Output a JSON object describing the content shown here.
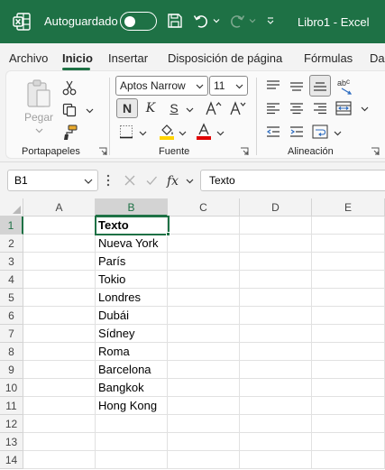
{
  "titlebar": {
    "autosave_label": "Autoguardado",
    "doc_title": "Libro1  -  Excel",
    "autosave_on": false
  },
  "tabs": [
    {
      "label": "Archivo",
      "active": false
    },
    {
      "label": "Inicio",
      "active": true
    },
    {
      "label": "Insertar",
      "active": false
    },
    {
      "label": "Disposición de página",
      "active": false
    },
    {
      "label": "Fórmulas",
      "active": false
    },
    {
      "label": "Da",
      "active": false
    }
  ],
  "ribbon": {
    "paste_label": "Pegar",
    "font_name": "Aptos Narrow",
    "font_size": "11",
    "bold_label": "N",
    "italic_label": "K",
    "underline_label": "S",
    "groups": {
      "clipboard": "Portapapeles",
      "font": "Fuente",
      "alignment": "Alineación"
    },
    "fill_color": "#ffd400",
    "font_color": "#e00000"
  },
  "formula_bar": {
    "name_box": "B1",
    "content": "Texto"
  },
  "grid": {
    "columns": [
      "A",
      "B",
      "C",
      "D",
      "E"
    ],
    "selected_column": "B",
    "rows": [
      "1",
      "2",
      "3",
      "4",
      "5",
      "6",
      "7",
      "8",
      "9",
      "10",
      "11",
      "12",
      "13",
      "14"
    ],
    "selected_row": "1",
    "column_b": [
      "Texto",
      "Nueva York",
      "París",
      "Tokio",
      "Londres",
      "Dubái",
      "Sídney",
      "Roma",
      "Barcelona",
      "Bangkok",
      "Hong Kong",
      "",
      "",
      ""
    ]
  },
  "colors": {
    "accent": "#1e7145",
    "ribbon_bg": "#f3f3f3"
  }
}
